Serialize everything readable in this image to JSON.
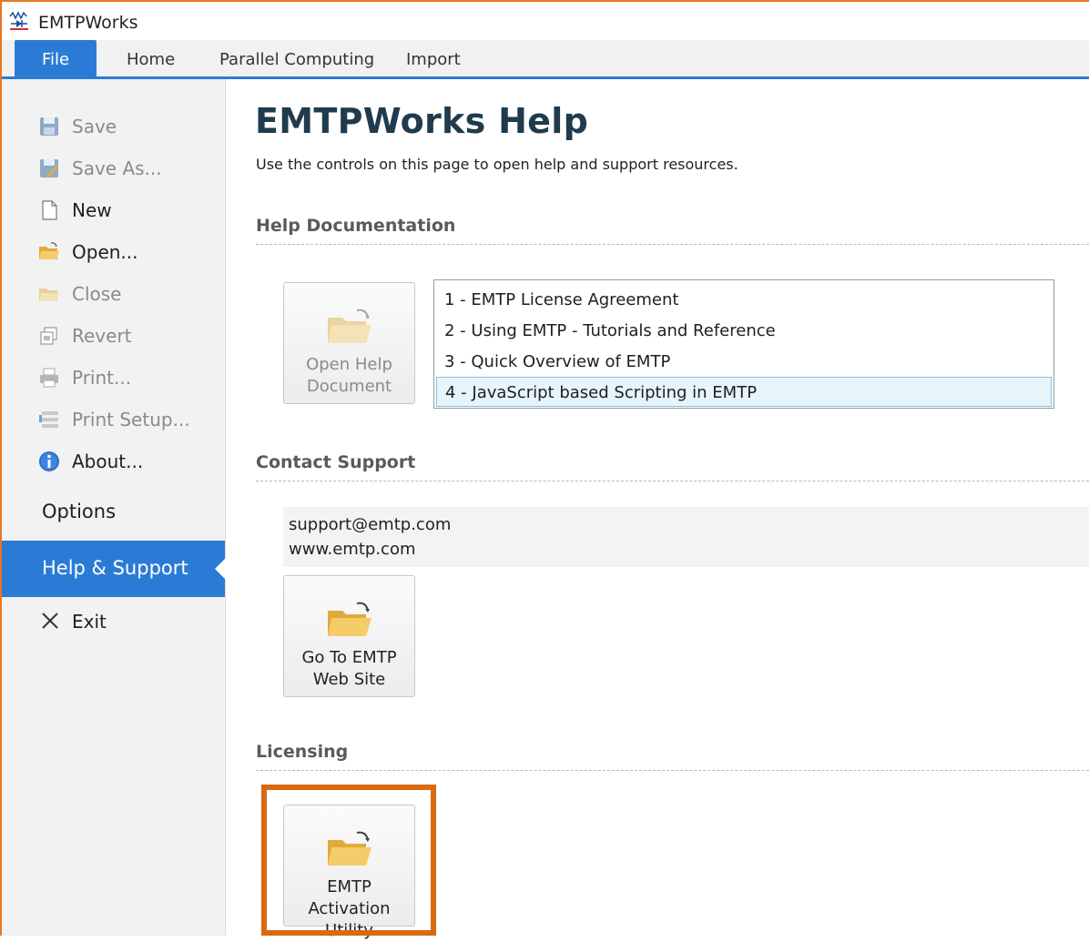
{
  "app": {
    "title": "EMTPWorks"
  },
  "ribbon": {
    "tabs": [
      {
        "label": "File",
        "active": true
      },
      {
        "label": "Home"
      },
      {
        "label": "Parallel Computing"
      },
      {
        "label": "Import"
      }
    ]
  },
  "sidebar": {
    "items": [
      {
        "label": "Save",
        "icon": "save-icon",
        "enabled": false
      },
      {
        "label": "Save As...",
        "icon": "save-as-icon",
        "enabled": false
      },
      {
        "label": "New",
        "icon": "new-document-icon",
        "enabled": true
      },
      {
        "label": "Open...",
        "icon": "open-folder-icon",
        "enabled": true
      },
      {
        "label": "Close",
        "icon": "close-folder-icon",
        "enabled": false
      },
      {
        "label": "Revert",
        "icon": "revert-icon",
        "enabled": false
      },
      {
        "label": "Print...",
        "icon": "printer-icon",
        "enabled": false
      },
      {
        "label": "Print Setup...",
        "icon": "print-setup-icon",
        "enabled": false
      },
      {
        "label": "About...",
        "icon": "info-icon",
        "enabled": true
      }
    ],
    "options_label": "Options",
    "help_label": "Help & Support",
    "exit_label": "Exit"
  },
  "main": {
    "title": "EMTPWorks Help",
    "subtitle": "Use the controls on this page to open help and support resources.",
    "help_section": {
      "heading": "Help Documentation",
      "open_button": {
        "line1": "Open Help",
        "line2": "Document",
        "enabled": false
      },
      "documents": [
        "1 - EMTP License Agreement",
        "2 - Using EMTP - Tutorials and Reference",
        "3 - Quick Overview of EMTP",
        "4 - JavaScript based Scripting in EMTP"
      ],
      "selected_index": 3
    },
    "contact_section": {
      "heading": "Contact Support",
      "email": "support@emtp.com",
      "website": "www.emtp.com",
      "button": {
        "line1": "Go To EMTP",
        "line2": "Web Site"
      }
    },
    "licensing_section": {
      "heading": "Licensing",
      "button": {
        "line1": "EMTP Activation",
        "line2": "Utility"
      }
    }
  },
  "colors": {
    "accent": "#2b7bd6",
    "highlight": "#d86a10",
    "frame": "#e87722"
  }
}
